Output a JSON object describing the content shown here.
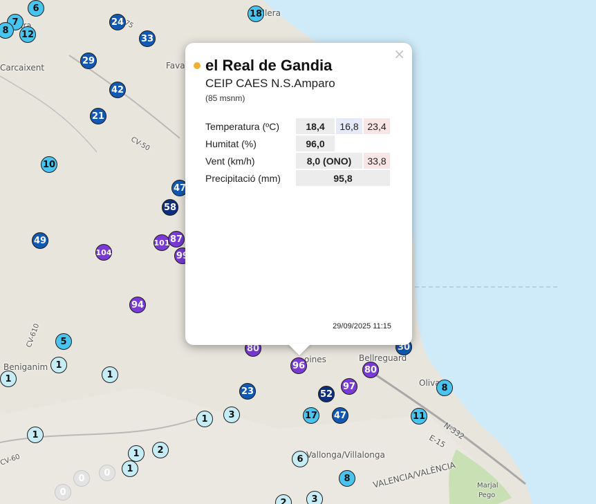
{
  "station": {
    "name": "el Real de Gandia",
    "subname": "CEIP CAES N.S.Amparo",
    "altitude": "(85 msnm)",
    "timestamp": "29/09/2025 11:15",
    "close_glyph": "×",
    "status_color": "#f0b030"
  },
  "table": {
    "temp_label": "Temperatura (ºC)",
    "temp_value": "18,4",
    "temp_min": "16,8",
    "temp_max": "23,4",
    "hum_label": "Humitat (%)",
    "hum_value": "96,0",
    "wind_label": "Vent (km/h)",
    "wind_value": "8,0 (ONO)",
    "wind_gust": "33,8",
    "precip_label": "Precipitació (mm)",
    "precip_value": "95,8"
  },
  "map_labels": [
    "Carcaixent",
    "Fava",
    "CV-50",
    "CV-610",
    "Beniganim",
    "CV-60",
    "Bellreguard",
    "oines",
    "Oliva",
    "N-332",
    "E-15",
    "Vallonga/Villalonga",
    "VALENCIA/VALÈNCIA",
    "Marjal",
    "Pego",
    "ira",
    "ullera",
    "75"
  ],
  "markers": [
    {
      "v": "6",
      "c": "c2"
    },
    {
      "v": "7",
      "c": "c2"
    },
    {
      "v": "8",
      "c": "c2"
    },
    {
      "v": "12",
      "c": "c2"
    },
    {
      "v": "24",
      "c": "c3"
    },
    {
      "v": "33",
      "c": "c3"
    },
    {
      "v": "18",
      "c": "c2"
    },
    {
      "v": "29",
      "c": "c3"
    },
    {
      "v": "42",
      "c": "c3"
    },
    {
      "v": "21",
      "c": "c3"
    },
    {
      "v": "10",
      "c": "c2"
    },
    {
      "v": "47",
      "c": "c3"
    },
    {
      "v": "58",
      "c": "c4"
    },
    {
      "v": "49",
      "c": "c3"
    },
    {
      "v": "104",
      "c": "c5"
    },
    {
      "v": "101",
      "c": "c5"
    },
    {
      "v": "87",
      "c": "c5"
    },
    {
      "v": "99",
      "c": "c5"
    },
    {
      "v": "94",
      "c": "c5"
    },
    {
      "v": "5",
      "c": "c2"
    },
    {
      "v": "1",
      "c": "c1"
    },
    {
      "v": "1",
      "c": "c1"
    },
    {
      "v": "1",
      "c": "c1"
    },
    {
      "v": "80",
      "c": "c5"
    },
    {
      "v": "96",
      "c": "c5"
    },
    {
      "v": "80",
      "c": "c5"
    },
    {
      "v": "30",
      "c": "c3"
    },
    {
      "v": "97",
      "c": "c5"
    },
    {
      "v": "23",
      "c": "c3"
    },
    {
      "v": "52",
      "c": "c4"
    },
    {
      "v": "8",
      "c": "c2"
    },
    {
      "v": "11",
      "c": "c2"
    },
    {
      "v": "17",
      "c": "c2"
    },
    {
      "v": "47",
      "c": "c3"
    },
    {
      "v": "3",
      "c": "c1"
    },
    {
      "v": "1",
      "c": "c1"
    },
    {
      "v": "1",
      "c": "c1"
    },
    {
      "v": "2",
      "c": "c1"
    },
    {
      "v": "1",
      "c": "c1"
    },
    {
      "v": "1",
      "c": "c1"
    },
    {
      "v": "0",
      "c": "c0"
    },
    {
      "v": "0",
      "c": "c0"
    },
    {
      "v": "0",
      "c": "c0"
    },
    {
      "v": "6",
      "c": "c1"
    },
    {
      "v": "8",
      "c": "c2"
    },
    {
      "v": "2",
      "c": "c1"
    },
    {
      "v": "3",
      "c": "c1"
    }
  ]
}
